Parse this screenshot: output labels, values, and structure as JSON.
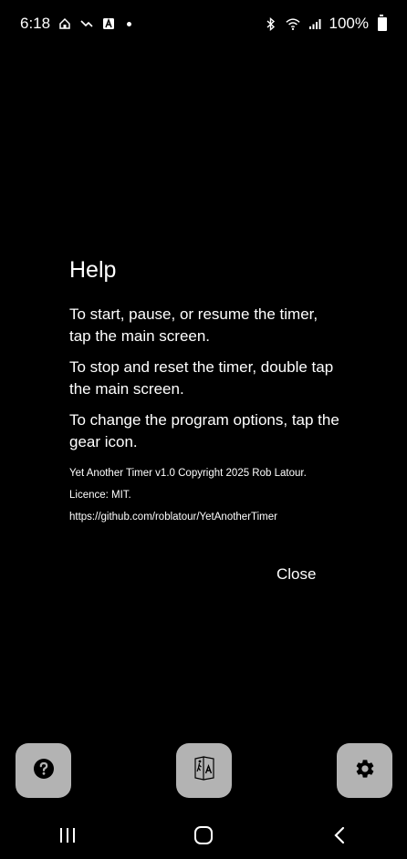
{
  "status_bar": {
    "time": "6:18",
    "battery": "100%"
  },
  "dialog": {
    "title": "Help",
    "paragraphs": [
      "To start, pause, or resume the timer, tap the main screen.",
      "To stop and reset the timer, double tap the main screen.",
      "To change the program options, tap the gear icon."
    ],
    "footer": [
      "Yet Another Timer v1.0 Copyright 2025 Rob Latour.",
      "Licence: MIT.",
      "https://github.com/roblatour/YetAnotherTimer"
    ],
    "close_label": "Close"
  },
  "bottom_buttons": {
    "help_icon": "help-circle-icon",
    "mode_icon": "walk-text-icon",
    "settings_icon": "gear-icon",
    "background": "#b3b3b3"
  },
  "nav_bar": {
    "recents_icon": "recents-icon",
    "home_icon": "home-icon",
    "back_icon": "back-icon"
  }
}
